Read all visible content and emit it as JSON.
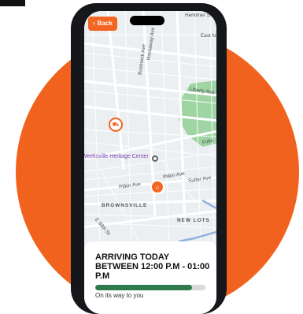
{
  "header": {
    "back_label": "Back"
  },
  "map": {
    "street_labels": [
      "Herkimer St",
      "East N",
      "Rockaway Ave",
      "Bushwick Ave",
      "Liberty Ave",
      "Fulto",
      "Pitkin Ave",
      "Pitkin Ave",
      "Sutter Ave",
      "BROWNSVILLE",
      "NEW LOTS",
      "E 98th St"
    ],
    "poi": "Weeksville Heritage Center"
  },
  "delivery": {
    "title": "ARRIVING TODAY BETWEEN 12:00 P.M - 01:00 P.M",
    "progress_percent": 88,
    "status": "On its way to you"
  },
  "colors": {
    "accent": "#f26522",
    "progress": "#2f7a4c",
    "park": "#9fd5a3"
  },
  "icons": {
    "back": "chevron-left-icon",
    "truck": "truck-icon",
    "home": "home-icon",
    "transit": "transit-icon"
  }
}
